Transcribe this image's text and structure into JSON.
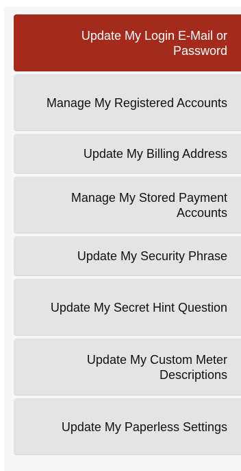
{
  "colors": {
    "active_bg": "#a42a1c",
    "item_bg": "#e4e4e4",
    "panel_bg": "#f7f7f7"
  },
  "sidebar": {
    "items": [
      {
        "label": "Update My Login E-Mail or Password",
        "active": true
      },
      {
        "label": "Manage My Registered Accounts",
        "active": false
      },
      {
        "label": "Update My Billing Address",
        "active": false
      },
      {
        "label": "Manage My Stored Payment Accounts",
        "active": false
      },
      {
        "label": "Update My Security Phrase",
        "active": false
      },
      {
        "label": "Update My Secret Hint Question",
        "active": false
      },
      {
        "label": "Update My Custom Meter Descriptions",
        "active": false
      },
      {
        "label": "Update My Paperless Settings",
        "active": false
      }
    ]
  }
}
